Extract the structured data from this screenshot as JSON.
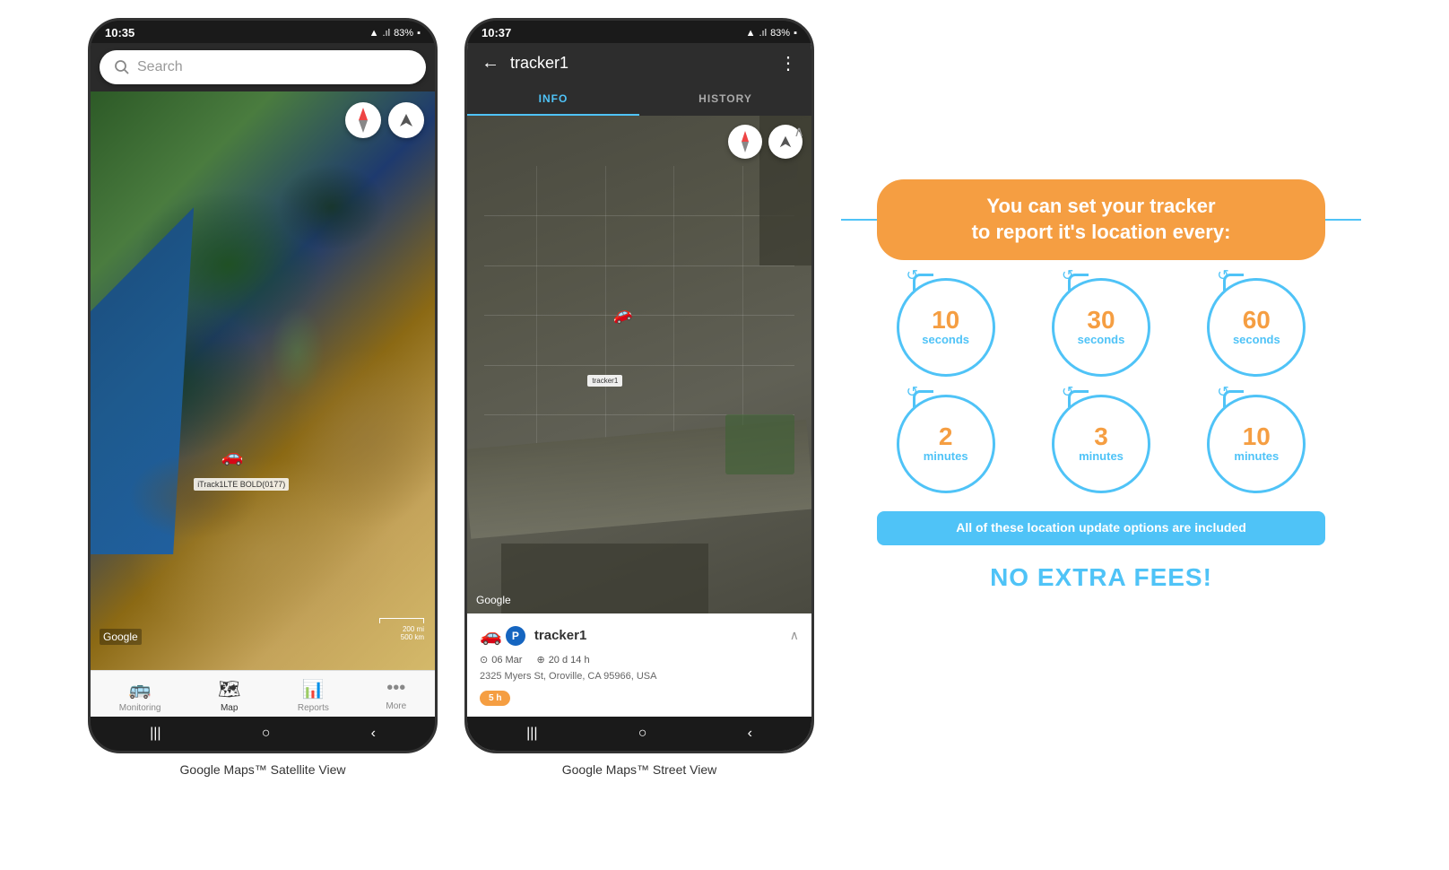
{
  "phone1": {
    "statusBar": {
      "time": "10:35",
      "signal": "▲▲▲",
      "network": ".ıl",
      "battery": "83%",
      "batteryIcon": "🔋"
    },
    "searchBar": {
      "placeholder": "Search"
    },
    "map": {
      "trackerLabel": "iTrack1LTE BOLD(0177)",
      "googleLogo": "Google",
      "scaleText1": "200 mi",
      "scaleText2": "500 km"
    },
    "nav": {
      "items": [
        {
          "label": "Monitoring",
          "icon": "🚌",
          "active": false
        },
        {
          "label": "Map",
          "icon": "🗺",
          "active": true
        },
        {
          "label": "Reports",
          "icon": "📊",
          "active": false
        },
        {
          "label": "More",
          "icon": "•••",
          "active": false
        }
      ]
    },
    "caption": "Google Maps™ Satellite View"
  },
  "phone2": {
    "statusBar": {
      "time": "10:37",
      "signal": "▲▲▲",
      "network": ".ıl",
      "battery": "83%"
    },
    "header": {
      "backLabel": "←",
      "title": "tracker1",
      "moreLabel": "⋮"
    },
    "tabs": [
      {
        "label": "INFO",
        "active": true
      },
      {
        "label": "HISTORY",
        "active": false
      }
    ],
    "map": {
      "trackerLabel": "tracker1",
      "googleLogo": "Google"
    },
    "trackerInfo": {
      "name": "tracker1",
      "parkingLabel": "P",
      "date": "06 Mar",
      "duration": "20 d 14 h",
      "address": "2325 Myers St, Oroville, CA 95966, USA",
      "timeBadge": "5 h"
    },
    "caption": "Google Maps™ Street View"
  },
  "infoGraphic": {
    "title": "You can set your tracker\nto report it's location every:",
    "intervals": [
      {
        "number": "10",
        "unit": "seconds"
      },
      {
        "number": "30",
        "unit": "seconds"
      },
      {
        "number": "60",
        "unit": "seconds"
      },
      {
        "number": "2",
        "unit": "minutes"
      },
      {
        "number": "3",
        "unit": "minutes"
      },
      {
        "number": "10",
        "unit": "minutes"
      }
    ],
    "includedText": "All of these location update options are included",
    "noFeesText": "NO EXTRA FEES!",
    "accentColor": "#f59e42",
    "lightBlue": "#4fc3f7"
  }
}
